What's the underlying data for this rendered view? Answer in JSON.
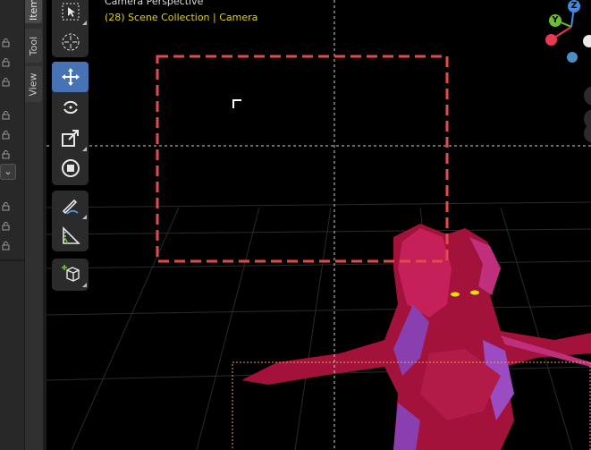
{
  "viewport": {
    "view_mode": "Camera Perspective",
    "scene_info": "(28) Scene Collection | Camera"
  },
  "sidebar_tabs": [
    {
      "label": "Item"
    },
    {
      "label": "Tool"
    },
    {
      "label": "View"
    }
  ],
  "toolbar": {
    "tools": [
      {
        "name": "select-box",
        "icon": "cursor-box-icon"
      },
      {
        "name": "cursor",
        "icon": "crosshair-cursor-icon"
      },
      {
        "name": "move",
        "icon": "move-arrows-icon",
        "active": true
      },
      {
        "name": "rotate",
        "icon": "rotate-icon"
      },
      {
        "name": "scale",
        "icon": "scale-icon"
      },
      {
        "name": "transform",
        "icon": "transform-icon"
      },
      {
        "name": "annotate",
        "icon": "pencil-icon"
      },
      {
        "name": "measure",
        "icon": "ruler-icon"
      },
      {
        "name": "add-cube",
        "icon": "add-cube-icon"
      }
    ]
  },
  "gizmo": {
    "axes": [
      {
        "label": "Y",
        "color": "#6bbf2f"
      },
      {
        "label": "Z",
        "color": "#3b8fe6"
      }
    ],
    "x_color": "#e83a55",
    "neg_x_color": "#eaeaea",
    "neg_y_color": "#4f8cbf"
  },
  "colors": {
    "active_tool": "#4772b3",
    "camera_frame": "#e34b4b",
    "scene_text": "#e4d200",
    "character": "#b0143c"
  }
}
